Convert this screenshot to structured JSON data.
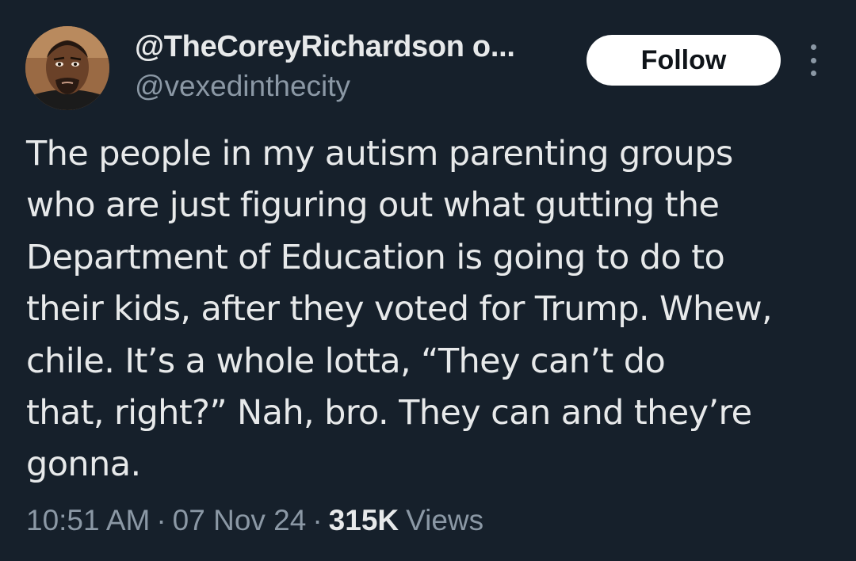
{
  "author": {
    "display_name": "@TheCoreyRichardson o...",
    "handle": "@vexedinthecity"
  },
  "actions": {
    "follow_label": "Follow",
    "more_icon": "more-vertical-icon"
  },
  "tweet": {
    "text_lines": [
      "The people in my autism parenting groups",
      "who are just figuring out what gutting the",
      "Department of Education is going to do to",
      "their kids, after they voted for Trump. Whew,",
      "chile. It’s a whole lotta, “They can’t do",
      "that, right?” Nah, bro. They can and they’re",
      "gonna."
    ]
  },
  "meta": {
    "time": "10:51 AM",
    "separator": "·",
    "date": "07 Nov 24",
    "views_count": "315K",
    "views_label": "Views"
  },
  "colors": {
    "background": "#16202b",
    "primary_text": "#e7e9ea",
    "secondary_text": "#8b98a5",
    "button_bg": "#ffffff"
  }
}
